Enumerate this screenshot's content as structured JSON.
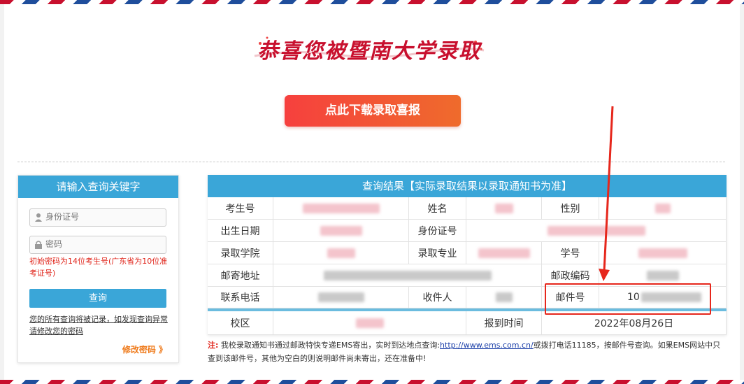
{
  "header": {
    "title": "恭喜您被暨南大学录取",
    "download_button": "点此下载录取喜报"
  },
  "query_panel": {
    "title": "请输入查询关键字",
    "id_placeholder": "身份证号",
    "password_placeholder": "密码",
    "password_hint": "初始密码为14位考生号(广东省为10位准考证号)",
    "query_button": "查询",
    "notice": "您的所有查询将被记录，如发现查询异常请修改您的密码",
    "change_password": "修改密码 》"
  },
  "result": {
    "title": "查询结果【实际录取结果以录取通知书为准】",
    "labels": {
      "exam_no": "考生号",
      "name": "姓名",
      "gender": "性别",
      "birth_date": "出生日期",
      "id_number": "身份证号",
      "college": "录取学院",
      "major": "录取专业",
      "student_no": "学号",
      "address": "邮寄地址",
      "postal_code": "邮政编码",
      "phone": "联系电话",
      "recipient": "收件人",
      "tracking_no": "邮件号",
      "campus": "校区",
      "report_time": "报到时间"
    },
    "tracking_no_visible": "10",
    "report_time": "2022年08月26日"
  },
  "footnote": {
    "label": "注:",
    "text_before_link": "我校录取通知书通过邮政特快专递EMS寄出，实时到达地点查询:",
    "link": "http://www.ems.com.cn/",
    "text_after_link": "或拨打电话11185，按邮件号查询。如果EMS网站中只查到该邮件号，其他为空白的则说明邮件尚未寄出，还在准备中!"
  },
  "colors": {
    "header_blue": "#3aa6d8",
    "button_red": "#f6403e",
    "button_orange": "#ef6b2c",
    "annotation_red": "#e6271c"
  }
}
